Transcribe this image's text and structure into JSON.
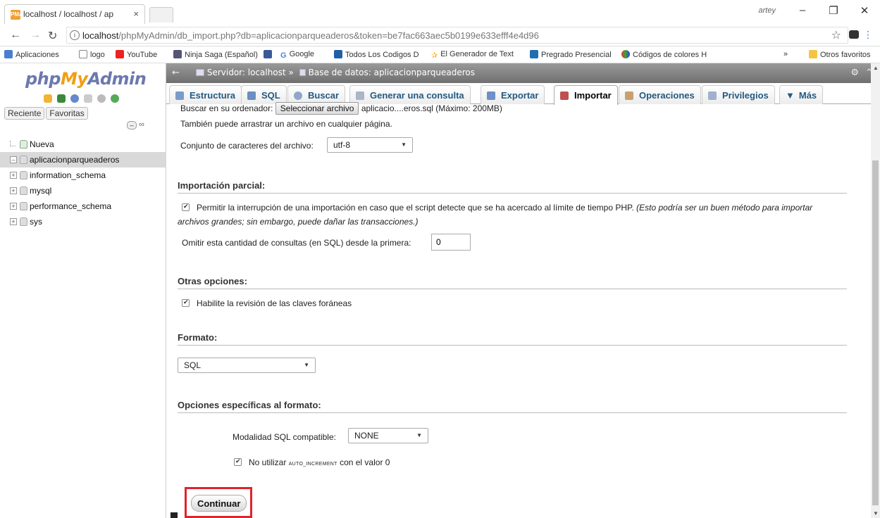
{
  "browser": {
    "tab_title": "localhost / localhost / ap",
    "tab_close": "×",
    "profile": "artey",
    "url_host": "localhost",
    "url_path": "/phpMyAdmin/db_import.php?db=aplicacionparqueaderos&token=be7fac663aec5b0199e633efff4e4d96",
    "bookmarks": [
      "Aplicaciones",
      "logo",
      "YouTube",
      "Ninja Saga (Español)",
      "Google",
      "Todos Los Codigos D",
      "El Generador de Text",
      "Pregrado Presencial",
      "Códigos de colores H"
    ],
    "bookmarks_more": "»",
    "other_bookmarks": "Otros favoritos"
  },
  "nav": {
    "logo_php": "php",
    "logo_my": "My",
    "logo_admin": "Admin",
    "recent": "Reciente",
    "favorites": "Favoritas",
    "databases": [
      "Nueva",
      "aplicacionparqueaderos",
      "information_schema",
      "mysql",
      "performance_schema",
      "sys"
    ]
  },
  "breadcrumb": {
    "server": "Servidor: localhost",
    "sep": "»",
    "database": "Base de datos: aplicacionparqueaderos"
  },
  "tabs": [
    "Estructura",
    "SQL",
    "Buscar",
    "Generar una consulta",
    "Exportar",
    "Importar",
    "Operaciones",
    "Privilegios",
    "Más"
  ],
  "tab_icon_colors": [
    "#7a9bc9",
    "#6a8fc0",
    "#8fa7c8",
    "#aab6c8",
    "#6f8fc7",
    "#c05050",
    "#c8a070",
    "#9fb0d0",
    "#333333"
  ],
  "form": {
    "browse_label": "Buscar en su ordenador:",
    "browse_button": "Seleccionar archivo",
    "file_name": "aplicacio....eros.sql",
    "max_size": "(Máximo: 200MB)",
    "drag_hint": "También puede arrastrar un archivo en cualquier página.",
    "charset_label": "Conjunto de caracteres del archivo:",
    "charset_value": "utf-8",
    "partial_title": "Importación parcial:",
    "allow_interrupt": "Permitir la interrupción de una importación en caso que el script detecte que se ha acercado al límite de tiempo PHP.",
    "allow_interrupt_note1": "(Esto podría ser un buen método para importar",
    "allow_interrupt_note2": "archivos grandes; sin embargo, puede dañar las transacciones.)",
    "skip_label": "Omitir esta cantidad de consultas (en SQL) desde la primera:",
    "skip_value": "0",
    "other_title": "Otras opciones:",
    "fk_check": "Habilite la revisión de las claves foráneas",
    "format_title": "Formato:",
    "format_value": "SQL",
    "format_specific_title": "Opciones específicas al formato:",
    "sql_compat_label": "Modalidad SQL compatible:",
    "sql_compat_value": "NONE",
    "no_autoinc_pre": "No utilizar",
    "no_autoinc_code": "AUTO_INCREMENT",
    "no_autoinc_post": "con el valor 0",
    "submit": "Continuar"
  },
  "colors": {
    "highlight": "#e0232c",
    "tab_text": "#235a81"
  }
}
